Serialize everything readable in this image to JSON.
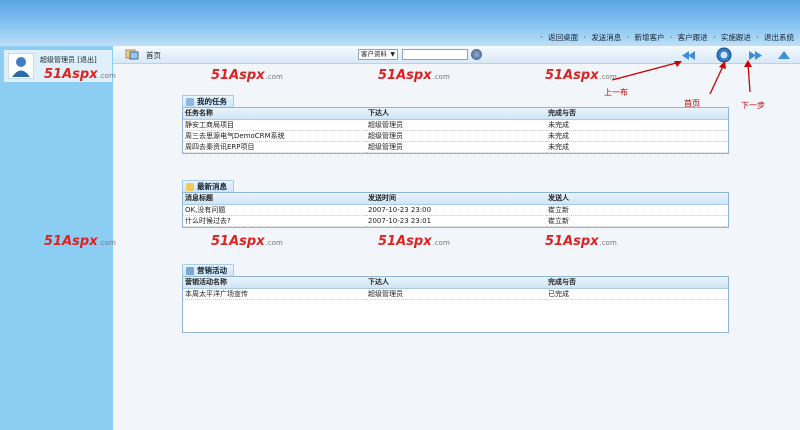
{
  "topbar": {
    "links": [
      "返回桌面",
      "发送消息",
      "新增客户",
      "客户跟进",
      "实施跟进",
      "退出系统"
    ]
  },
  "sidebar": {
    "user_label": "超级管理员",
    "logout_label": "[退出]"
  },
  "toolbar": {
    "home_label": "首页",
    "select_value": "客户资料",
    "search_value": ""
  },
  "watermark": {
    "text": "51Aspx",
    "suffix": ".com"
  },
  "annotations": {
    "prev": "上一布",
    "home": "首页",
    "next": "下一步"
  },
  "tasks": {
    "title": "我的任务",
    "headers": [
      "任务名称",
      "下达人",
      "完成与否"
    ],
    "rows": [
      [
        "静安工商局项目",
        "超级管理员",
        "未完成"
      ],
      [
        "周三去思源电气DemoCRM系统",
        "超级管理员",
        "未完成"
      ],
      [
        "周四去秦资讯ERP项目",
        "超级管理员",
        "未完成"
      ]
    ]
  },
  "news": {
    "title": "最新消息",
    "headers": [
      "消息标题",
      "发送时间",
      "发送人"
    ],
    "rows": [
      [
        "OK,没有问题",
        "2007-10-23 23:00",
        "崔立新"
      ],
      [
        "什么时候过去?",
        "2007-10-23 23:01",
        "崔立新"
      ]
    ]
  },
  "marketing": {
    "title": "营销活动",
    "headers": [
      "营销活动名称",
      "下达人",
      "完成与否"
    ],
    "rows": [
      [
        "本周太平洋广场宣传",
        "超级管理员",
        "已完成"
      ]
    ]
  },
  "colors": {
    "accent": "#8ccdf4",
    "watermark": "#dd2222",
    "annotation": "#bb0000"
  },
  "icons": [
    "avatar-icon",
    "home-icon",
    "prev-icon",
    "home-nav-icon",
    "next-icon",
    "up-icon",
    "go-icon"
  ]
}
